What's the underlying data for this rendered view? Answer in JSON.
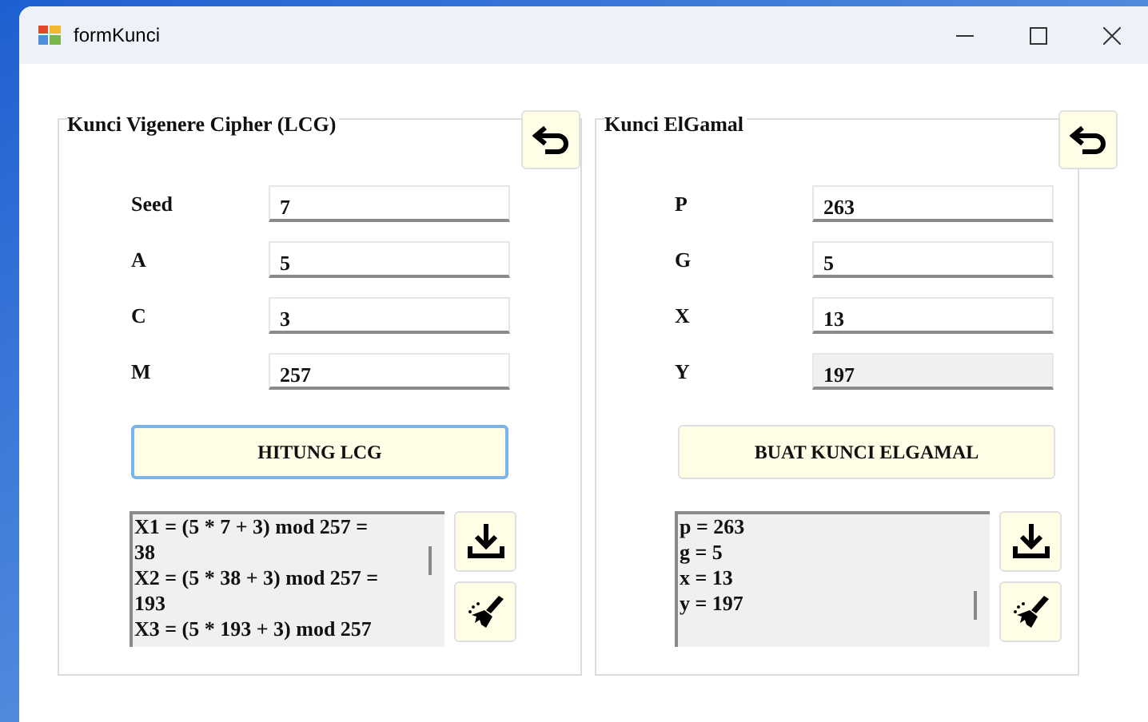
{
  "window": {
    "title": "formKunci"
  },
  "panels": [
    {
      "title": "Kunci Vigenere Cipher (LCG)",
      "fields": [
        {
          "label": "Seed",
          "value": "7",
          "disabled": false
        },
        {
          "label": "A",
          "value": "5",
          "disabled": false
        },
        {
          "label": "C",
          "value": "3",
          "disabled": false
        },
        {
          "label": "M",
          "value": "257",
          "disabled": false
        }
      ],
      "action": {
        "label": "HITUNG LCG",
        "focused": true
      },
      "output": "X1 = (5 * 7 + 3) mod 257 =\n38\nX2 = (5 * 38 + 3) mod 257 =\n193\nX3 = (5 * 193 + 3) mod 257"
    },
    {
      "title": "Kunci ElGamal",
      "fields": [
        {
          "label": "P",
          "value": "263",
          "disabled": false
        },
        {
          "label": "G",
          "value": "5",
          "disabled": false
        },
        {
          "label": "X",
          "value": "13",
          "disabled": false
        },
        {
          "label": "Y",
          "value": "197",
          "disabled": true
        }
      ],
      "action": {
        "label": "BUAT KUNCI ELGAMAL",
        "focused": false
      },
      "output": "p = 263\ng = 5\nx = 13\ny = 197"
    }
  ]
}
